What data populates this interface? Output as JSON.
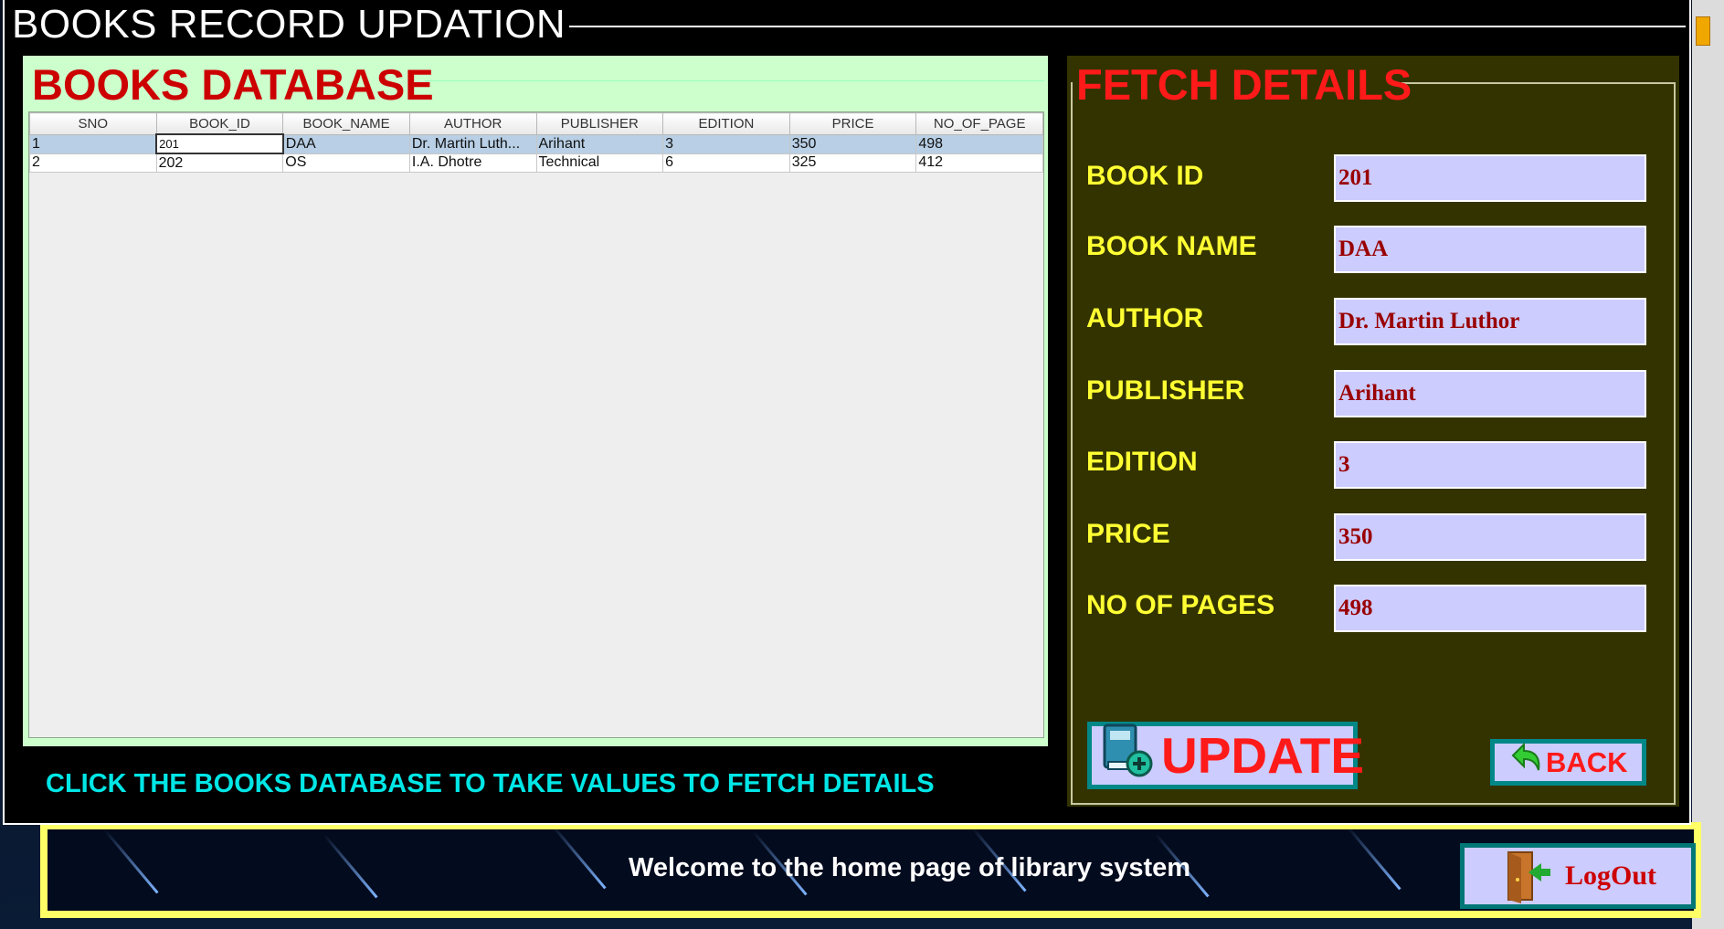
{
  "window": {
    "title": "BOOKS RECORD UPDATION"
  },
  "database_panel": {
    "title": "BOOKS DATABASE",
    "columns": [
      "SNO",
      "BOOK_ID",
      "BOOK_NAME",
      "AUTHOR",
      "PUBLISHER",
      "EDITION",
      "PRICE",
      "NO_OF_PAGE"
    ],
    "rows": [
      [
        "1",
        "201",
        "DAA",
        "Dr. Martin Luth...",
        "Arihant",
        "3",
        "350",
        "498"
      ],
      [
        "2",
        "202",
        "OS",
        "I.A. Dhotre",
        "Technical",
        "6",
        "325",
        "412"
      ]
    ],
    "selected_row": 0
  },
  "hint": "CLICK THE BOOKS  DATABASE TO TAKE VALUES TO FETCH DETAILS",
  "fetch_panel": {
    "title": "FETCH DETAILS",
    "fields": [
      {
        "label": "BOOK ID",
        "value": "201"
      },
      {
        "label": "BOOK NAME",
        "value": "DAA"
      },
      {
        "label": "AUTHOR",
        "value": "Dr. Martin Luthor"
      },
      {
        "label": "PUBLISHER",
        "value": "Arihant"
      },
      {
        "label": "EDITION",
        "value": "3"
      },
      {
        "label": "PRICE",
        "value": "350"
      },
      {
        "label": "NO OF PAGES",
        "value": "498"
      }
    ],
    "update_label": "UPDATE",
    "back_label": "BACK"
  },
  "home": {
    "welcome": "Welcome to the home page of library system",
    "logout_label": "LogOut"
  },
  "icons": {
    "update": "book-add-icon",
    "back": "back-arrow-icon",
    "logout": "door-exit-icon"
  },
  "colors": {
    "db_panel_bg": "#ccffcc",
    "fetch_panel_bg": "#333300",
    "title_red": "#cc0000",
    "label_yellow": "#ffff33",
    "input_bg": "#ccccff",
    "hint_cyan": "#00e6e6"
  }
}
